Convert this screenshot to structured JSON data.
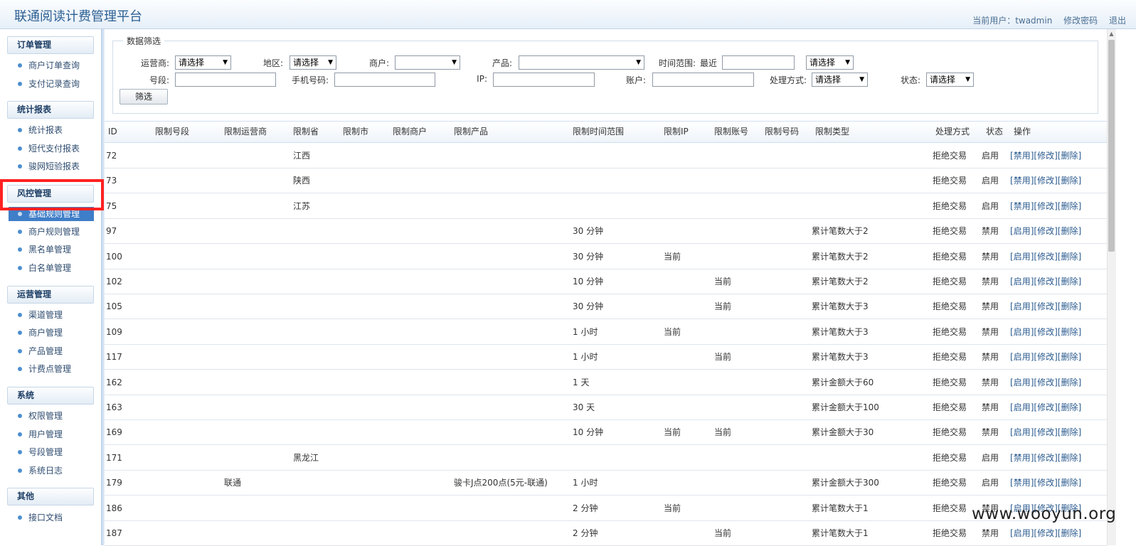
{
  "header": {
    "title": "联通阅读计费管理平台",
    "current_user_label": "当前用户：twadmin",
    "change_password": "修改密码",
    "logout": "退出"
  },
  "sidebar": {
    "sections": [
      {
        "title": "订单管理",
        "items": [
          "商户订单查询",
          "支付记录查询"
        ]
      },
      {
        "title": "统计报表",
        "items": [
          "统计报表",
          "短代支付报表",
          "骏网短验报表"
        ]
      },
      {
        "title": "风控管理",
        "items": [
          "基础规则管理",
          "商户规则管理",
          "黑名单管理",
          "白名单管理"
        ]
      },
      {
        "title": "运营管理",
        "items": [
          "渠道管理",
          "商户管理",
          "产品管理",
          "计费点管理"
        ]
      },
      {
        "title": "系统",
        "items": [
          "权限管理",
          "用户管理",
          "号段管理",
          "系统日志"
        ]
      },
      {
        "title": "其他",
        "items": [
          "接口文档"
        ]
      }
    ],
    "selected_item": "基础规则管理"
  },
  "filter": {
    "legend": "数据筛选",
    "operator_label": "运营商:",
    "operator_value": "请选择",
    "region_label": "地区:",
    "region_value": "请选择",
    "merchant_label": "商户:",
    "merchant_value": "",
    "product_label": "产品:",
    "product_value": "",
    "time_range_label": "时间范围:",
    "recent_label": "最近",
    "time_unit_value": "请选择",
    "segment_label": "号段:",
    "phone_label": "手机号码:",
    "ip_label": "IP:",
    "account_label": "账户:",
    "handle_label": "处理方式:",
    "handle_value": "请选择",
    "status_label": "状态:",
    "status_value": "请选择",
    "button": "筛选"
  },
  "table": {
    "columns": [
      "ID",
      "限制号段",
      "限制运营商",
      "限制省",
      "限制市",
      "限制商户",
      "限制产品",
      "限制时间范围",
      "限制IP",
      "限制账号",
      "限制号码",
      "限制类型",
      "处理方式",
      "状态",
      "操作"
    ],
    "rows": [
      {
        "id": "72",
        "segment": "",
        "operator": "",
        "province": "江西",
        "city": "",
        "merchant": "",
        "product": "",
        "time_range": "",
        "ip": "",
        "account": "",
        "number": "",
        "type": "",
        "handle": "拒绝交易",
        "status": "启用",
        "toggle": "禁用"
      },
      {
        "id": "73",
        "segment": "",
        "operator": "",
        "province": "陕西",
        "city": "",
        "merchant": "",
        "product": "",
        "time_range": "",
        "ip": "",
        "account": "",
        "number": "",
        "type": "",
        "handle": "拒绝交易",
        "status": "启用",
        "toggle": "禁用"
      },
      {
        "id": "75",
        "segment": "",
        "operator": "",
        "province": "江苏",
        "city": "",
        "merchant": "",
        "product": "",
        "time_range": "",
        "ip": "",
        "account": "",
        "number": "",
        "type": "",
        "handle": "拒绝交易",
        "status": "启用",
        "toggle": "禁用"
      },
      {
        "id": "97",
        "segment": "",
        "operator": "",
        "province": "",
        "city": "",
        "merchant": "",
        "product": "",
        "time_range": "30 分钟",
        "ip": "",
        "account": "",
        "number": "",
        "type": "累计笔数大于2",
        "handle": "拒绝交易",
        "status": "禁用",
        "toggle": "启用"
      },
      {
        "id": "100",
        "segment": "",
        "operator": "",
        "province": "",
        "city": "",
        "merchant": "",
        "product": "",
        "time_range": "30 分钟",
        "ip": "当前",
        "account": "",
        "number": "",
        "type": "累计笔数大于2",
        "handle": "拒绝交易",
        "status": "禁用",
        "toggle": "启用"
      },
      {
        "id": "102",
        "segment": "",
        "operator": "",
        "province": "",
        "city": "",
        "merchant": "",
        "product": "",
        "time_range": "10 分钟",
        "ip": "",
        "account": "当前",
        "number": "",
        "type": "累计笔数大于2",
        "handle": "拒绝交易",
        "status": "禁用",
        "toggle": "启用"
      },
      {
        "id": "105",
        "segment": "",
        "operator": "",
        "province": "",
        "city": "",
        "merchant": "",
        "product": "",
        "time_range": "30 分钟",
        "ip": "",
        "account": "当前",
        "number": "",
        "type": "累计笔数大于3",
        "handle": "拒绝交易",
        "status": "禁用",
        "toggle": "启用"
      },
      {
        "id": "109",
        "segment": "",
        "operator": "",
        "province": "",
        "city": "",
        "merchant": "",
        "product": "",
        "time_range": "1 小时",
        "ip": "当前",
        "account": "",
        "number": "",
        "type": "累计笔数大于3",
        "handle": "拒绝交易",
        "status": "禁用",
        "toggle": "启用"
      },
      {
        "id": "117",
        "segment": "",
        "operator": "",
        "province": "",
        "city": "",
        "merchant": "",
        "product": "",
        "time_range": "1 小时",
        "ip": "",
        "account": "当前",
        "number": "",
        "type": "累计笔数大于3",
        "handle": "拒绝交易",
        "status": "禁用",
        "toggle": "启用"
      },
      {
        "id": "162",
        "segment": "",
        "operator": "",
        "province": "",
        "city": "",
        "merchant": "",
        "product": "",
        "time_range": "1 天",
        "ip": "",
        "account": "",
        "number": "",
        "type": "累计金额大于60",
        "handle": "拒绝交易",
        "status": "禁用",
        "toggle": "启用"
      },
      {
        "id": "163",
        "segment": "",
        "operator": "",
        "province": "",
        "city": "",
        "merchant": "",
        "product": "",
        "time_range": "30 天",
        "ip": "",
        "account": "",
        "number": "",
        "type": "累计金额大于100",
        "handle": "拒绝交易",
        "status": "禁用",
        "toggle": "启用"
      },
      {
        "id": "169",
        "segment": "",
        "operator": "",
        "province": "",
        "city": "",
        "merchant": "",
        "product": "",
        "time_range": "10 分钟",
        "ip": "当前",
        "account": "当前",
        "number": "",
        "type": "累计金额大于30",
        "handle": "拒绝交易",
        "status": "禁用",
        "toggle": "启用"
      },
      {
        "id": "171",
        "segment": "",
        "operator": "",
        "province": "黑龙江",
        "city": "",
        "merchant": "",
        "product": "",
        "time_range": "",
        "ip": "",
        "account": "",
        "number": "",
        "type": "",
        "handle": "拒绝交易",
        "status": "启用",
        "toggle": "禁用"
      },
      {
        "id": "179",
        "segment": "",
        "operator": "联通",
        "province": "",
        "city": "",
        "merchant": "",
        "product": "骏卡J点200点(5元-联通)",
        "time_range": "1 小时",
        "ip": "",
        "account": "",
        "number": "",
        "type": "累计金额大于300",
        "handle": "拒绝交易",
        "status": "启用",
        "toggle": "禁用"
      },
      {
        "id": "186",
        "segment": "",
        "operator": "",
        "province": "",
        "city": "",
        "merchant": "",
        "product": "",
        "time_range": "2 分钟",
        "ip": "当前",
        "account": "",
        "number": "",
        "type": "累计笔数大于1",
        "handle": "拒绝交易",
        "status": "禁用",
        "toggle": "启用"
      },
      {
        "id": "187",
        "segment": "",
        "operator": "",
        "province": "",
        "city": "",
        "merchant": "",
        "product": "",
        "time_range": "2 分钟",
        "ip": "",
        "account": "当前",
        "number": "",
        "type": "累计笔数大于1",
        "handle": "拒绝交易",
        "status": "禁用",
        "toggle": "启用"
      }
    ],
    "op_edit": "修改",
    "op_delete": "删除"
  },
  "watermark": "www.wooyun.org"
}
